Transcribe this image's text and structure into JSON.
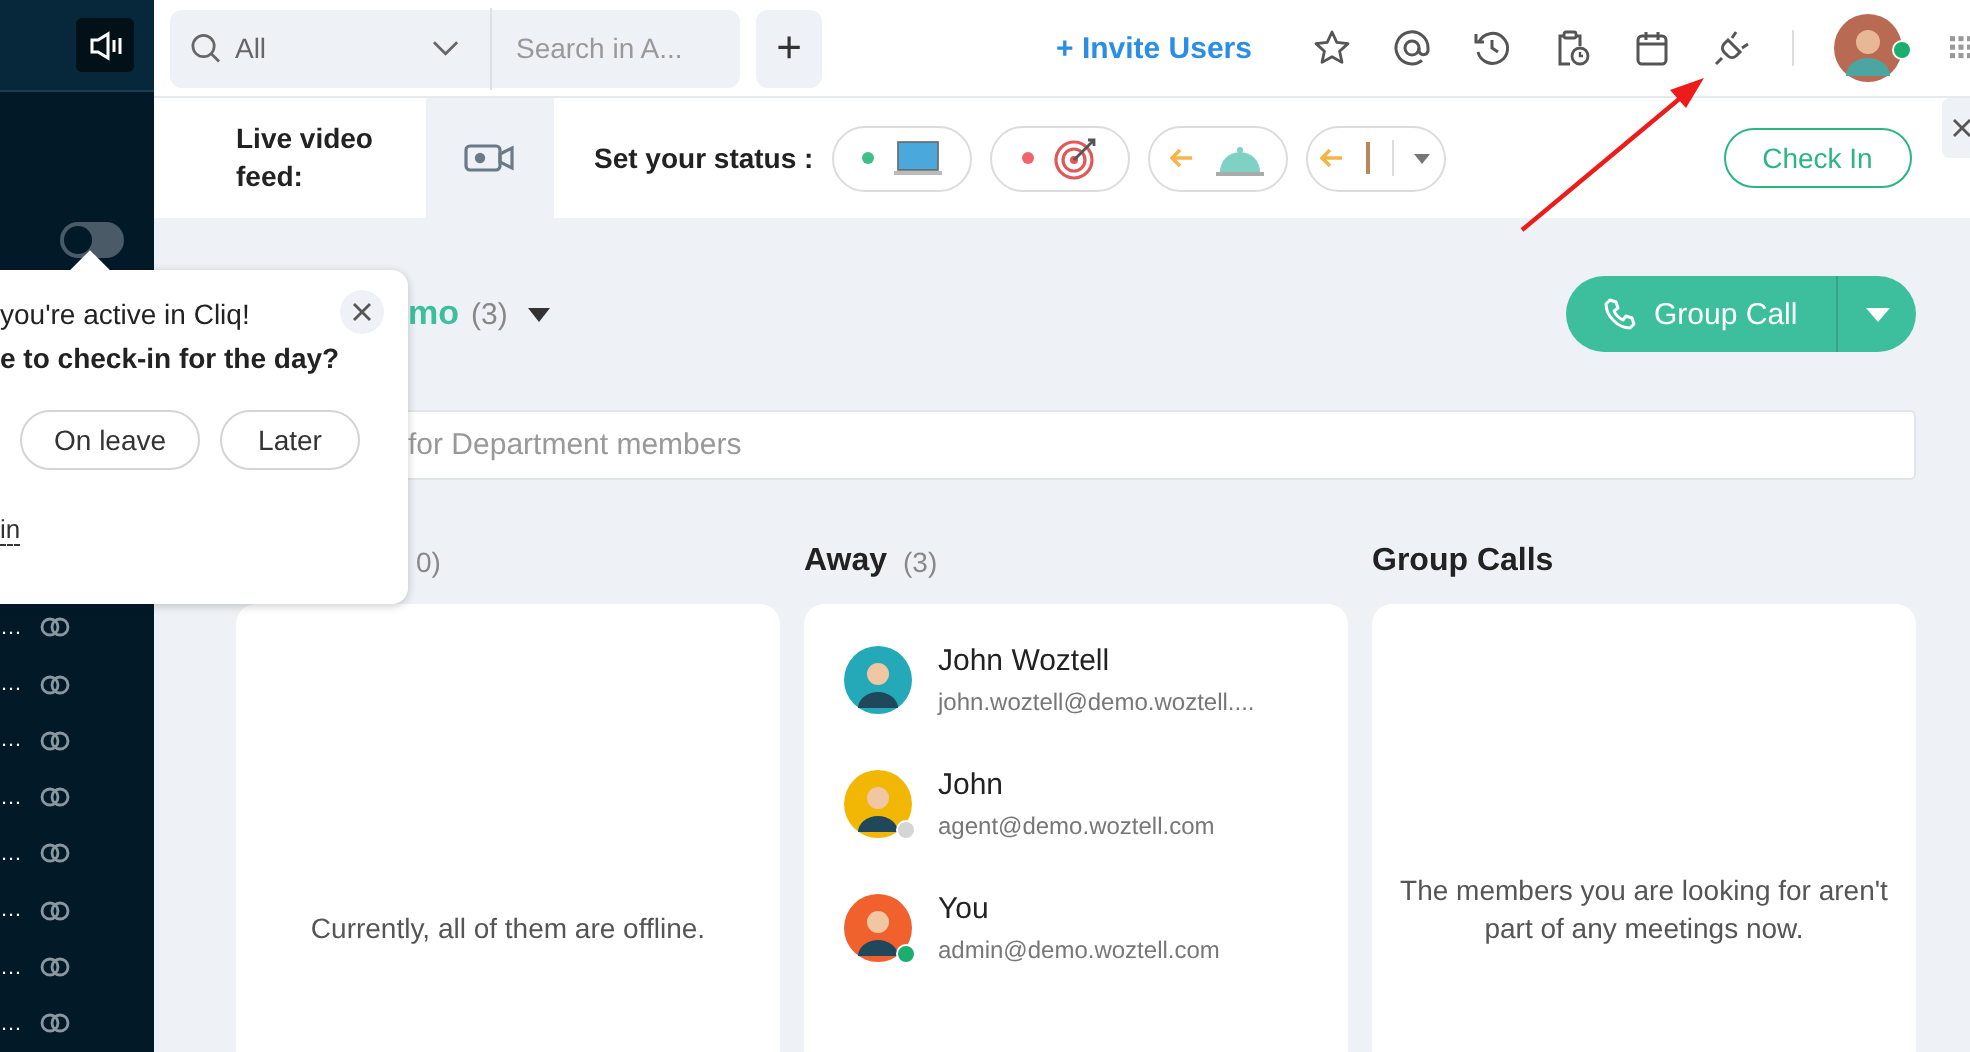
{
  "sidebar": {
    "toggle": {
      "on": false
    },
    "items": [
      {
        "label": "…"
      },
      {
        "label": "…"
      },
      {
        "label": "…"
      },
      {
        "label": "…"
      },
      {
        "label": "…"
      },
      {
        "label": "…"
      },
      {
        "label": "…"
      },
      {
        "label": "…"
      }
    ]
  },
  "topbar": {
    "search": {
      "scope": "All",
      "placeholder": "Search in A..."
    },
    "add_button": "+",
    "invite": "+ Invite Users",
    "profile": {
      "color": "#1aae6f"
    }
  },
  "status_bar": {
    "video_label": "Live video feed:",
    "status_label": "Set your status :",
    "statuses": [
      {
        "kind": "laptop",
        "color": "#3dbf8a"
      },
      {
        "kind": "target",
        "color": "#f0646a"
      },
      {
        "kind": "cloche",
        "color": "#f5b54a"
      },
      {
        "kind": "more",
        "color": "#f5b54a"
      }
    ],
    "check_in": "Check In"
  },
  "popup": {
    "line1": "you're active in Cliq!",
    "line2": "e to check-in for the day?",
    "buttons": [
      {
        "label": "On leave"
      },
      {
        "label": "Later"
      }
    ],
    "link": "in"
  },
  "department": {
    "title": "mo",
    "count": "(3)",
    "search_placeholder": "for Department members",
    "group_call": "Group Call"
  },
  "columns": [
    {
      "count": "0)",
      "empty_text": "Currently, all of them are offline."
    },
    {
      "title": "Away",
      "count": "(3)",
      "members": [
        {
          "name": "John Woztell",
          "email": "john.woztell@demo.woztell...."
        },
        {
          "name": "John",
          "email": "agent@demo.woztell.com",
          "color": "#d5d5d5"
        },
        {
          "name": "You",
          "email": "admin@demo.woztell.com",
          "color": "#1aae6f"
        }
      ]
    },
    {
      "title": "Group Calls",
      "empty_text": "The members you are looking for aren't part of any meetings now."
    }
  ]
}
